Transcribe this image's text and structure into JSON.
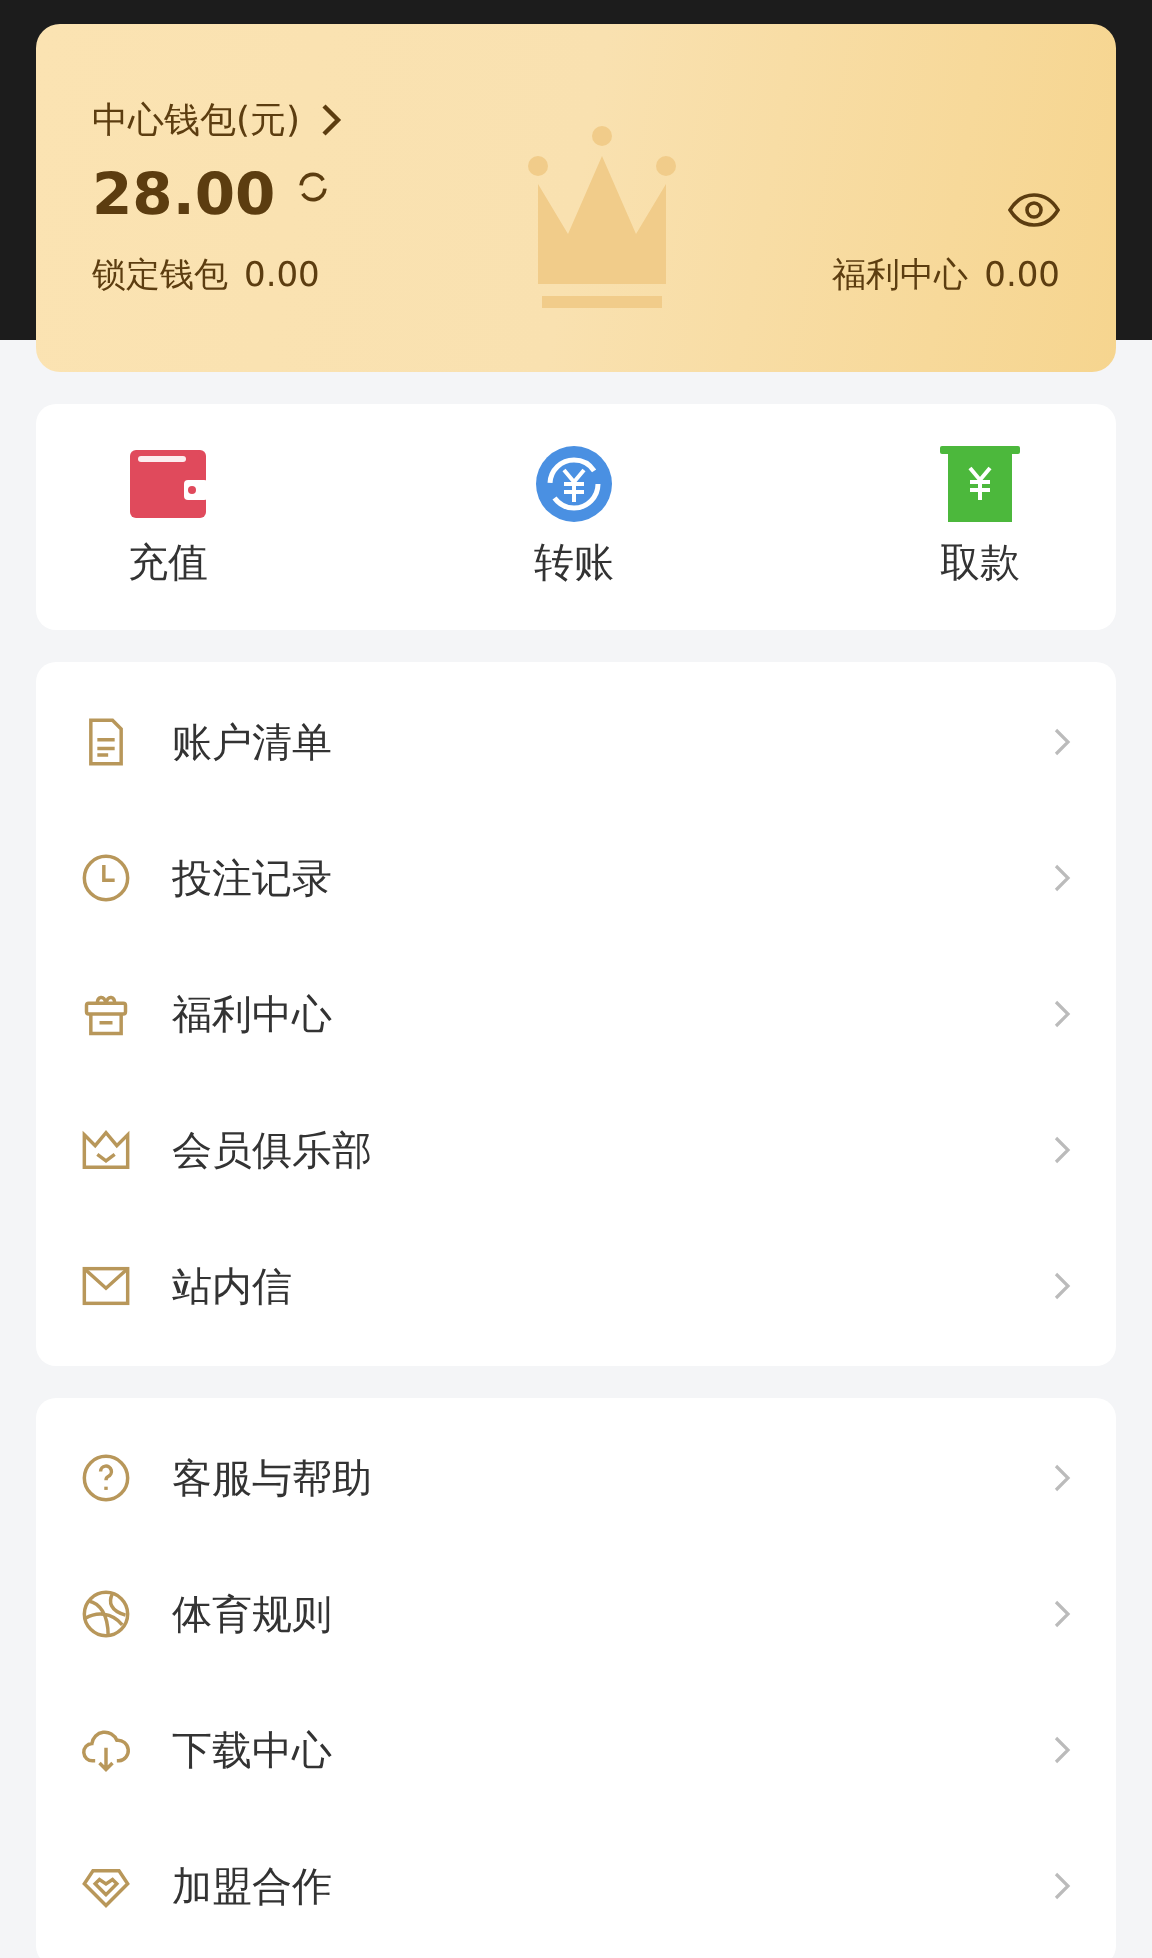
{
  "wallet": {
    "title": "中心钱包(元)",
    "balance": "28.00",
    "locked_label": "锁定钱包",
    "locked_value": "0.00",
    "welfare_label": "福利中心",
    "welfare_value": "0.00"
  },
  "actions": [
    {
      "label": "充值"
    },
    {
      "label": "转账"
    },
    {
      "label": "取款"
    }
  ],
  "menu_groups": [
    {
      "items": [
        {
          "label": "账户清单"
        },
        {
          "label": "投注记录"
        },
        {
          "label": "福利中心"
        },
        {
          "label": "会员俱乐部"
        },
        {
          "label": "站内信"
        }
      ]
    },
    {
      "items": [
        {
          "label": "客服与帮助"
        },
        {
          "label": "体育规则"
        },
        {
          "label": "下载中心"
        },
        {
          "label": "加盟合作"
        }
      ]
    }
  ]
}
